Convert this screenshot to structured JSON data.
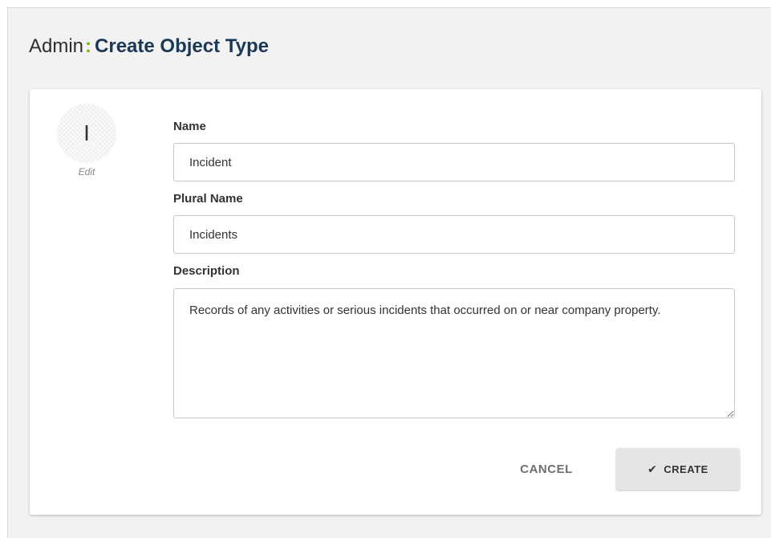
{
  "header": {
    "section": "Admin",
    "separator": ":",
    "title": "Create Object Type"
  },
  "avatar": {
    "initial": "I",
    "edit_label": "Edit"
  },
  "form": {
    "name": {
      "label": "Name",
      "value": "Incident"
    },
    "plural_name": {
      "label": "Plural Name",
      "value": "Incidents"
    },
    "description": {
      "label": "Description",
      "value": "Records of any activities or serious incidents that occurred on or near company property."
    }
  },
  "actions": {
    "cancel_label": "CANCEL",
    "create_label": "CREATE",
    "create_icon": "check-icon"
  },
  "colors": {
    "accent": "#7ab800",
    "title": "#1b3857",
    "page_bg": "#f2f2f2",
    "button_bg": "#e5e5e5"
  }
}
